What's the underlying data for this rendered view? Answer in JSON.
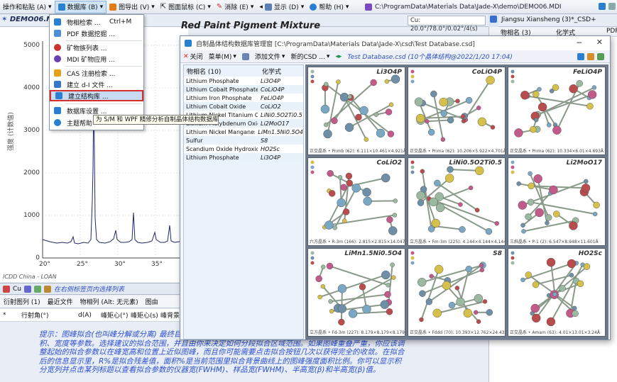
{
  "menubar": {
    "items": [
      {
        "label": "操作和粘贴 (A)",
        "arrow": "▾"
      },
      {
        "label": "数据库 (B)",
        "arrow": "▾"
      },
      {
        "label": "图导出 (V)",
        "arrow": "▾"
      },
      {
        "label": "图面鼠标 (C)",
        "arrow": "▾"
      },
      {
        "label": "消除 (E)",
        "arrow": "▾"
      },
      {
        "label": "显示 (D)",
        "arrow": "▾"
      },
      {
        "label": "帮助 (H)",
        "arrow": "▾"
      }
    ],
    "path": "C:\\ProgramData\\Materials Data\\Jade-X\\demo\\DEMO06.MDI"
  },
  "doc_tab": "DEMO06.MI",
  "cu_readout": "Cu: 20.0°/78.0°/0.02°/4(s)",
  "right_panel": {
    "title": "Jiangsu Xiansheng (3)*_CSD+",
    "col1": "物相名 (3)",
    "col2": "化学式",
    "col3": "PDF"
  },
  "plot": {
    "title": "Red Paint Pigment Mixture",
    "ylabel": "强度 (计数值)",
    "yticks": [
      "5000",
      "4000",
      "3000",
      "2000",
      "1000",
      "0"
    ],
    "xticks": [
      "20°",
      "25°",
      "30°",
      "35°"
    ],
    "footer": "ICDD China - LOAN"
  },
  "dropdown": {
    "items": [
      {
        "label": "物相检索 ...",
        "shortcut": "Ctrl+M"
      },
      {
        "label": "PDF 数据挖掘 ..."
      },
      {
        "label": "矿物族列表 ..."
      },
      {
        "label": "MDI 矿物应用 ..."
      },
      {
        "label": "CAS 注册检索 ..."
      },
      {
        "label": "建立 d-I 文件 ..."
      },
      {
        "label": "建立结构库 ..."
      },
      {
        "label": "数据库设置 ..."
      },
      {
        "label": "主题帮助"
      }
    ],
    "tooltip": "为 S/M 和 WPF 精修分析自制晶体结构数据库"
  },
  "bottom": {
    "toolbar_text": "在右侧标签页内选择列表",
    "toolbar_cu": "Cu",
    "tabs": [
      "衍射图列 (1)",
      "最近文件",
      "物相列 (Alt: 无元素)",
      "图由"
    ],
    "cols": [
      "行射角(°)",
      "d(A)",
      "峰矩心(°)",
      "峰矩心(s)",
      "峰背景"
    ],
    "row_marker": "*",
    "hint": "提示：图峰拟合(也叫峰分解或分离) 最终目的是利用峰形函数拟合所观测的峰形，据以精确确定峰的位置、面积、宽度等参数。选择建议的拟合范围，并且由你来决定如何分段拟合区域范围。如果图峰重叠严重，你应该调整起始的拟合参数以在峰宽高和位置上近似图峰，而且你可能需要点击拟合按钮几次以获得完全的收敛。在拟合后的信息显示里，R%是拟合残差值，面积%是当前范围里拟合背景曲线上的图峰强度面积比例。你可以显示积分宽列并点击某列标题以查看拟合参数的仪器宽(FWHM)、样品宽(FWHM)、半高宽(β)和半高宽(β)值。"
  },
  "dialog": {
    "title": "自制晶体结构数据库管理窗 [C:\\ProgramData\\Materials Data\\Jade-X\\csd\\Test Database.csd]",
    "toolbar": [
      "关闭",
      "菜单(M)",
      "添加文件",
      "新的CSD ...",
      "Test Database.csd (10个晶体结构@2022/1/20 17:04)"
    ],
    "list_header": {
      "name": "物相名",
      "count": "(10)",
      "formula": "化学式"
    },
    "rows": [
      {
        "name": "Lithium Phosphate",
        "formula": "Li3O4P"
      },
      {
        "name": "Lithium Cobalt Phosphate",
        "formula": "CoLiO4P"
      },
      {
        "name": "Lithium Iron Phosphate",
        "formula": "FeLiO4P"
      },
      {
        "name": "Lithium Cobalt Oxide",
        "formula": "CoLiO2"
      },
      {
        "name": "Lithium Nickel Titanium O...",
        "formula": "LiNi0.5O2Ti0.5"
      },
      {
        "name": "Lithium Molybdenum Oxide",
        "formula": "Li2MoO17"
      },
      {
        "name": "Lithium Nickel Manganes...",
        "formula": "LiMn1.5Ni0.5O4"
      },
      {
        "name": "Sulfur",
        "formula": "S8"
      },
      {
        "name": "Scandium Oxide Hydroxide",
        "formula": "HO2Sc"
      },
      {
        "name": "Lithium Phosphate",
        "formula": "Li3O4P"
      }
    ],
    "cells": [
      {
        "title": "Li3O4P",
        "caption": "正交晶系 • Pnmb (62): 6.111×10.461×4.921Å"
      },
      {
        "title": "CoLiO4P",
        "caption": "正交晶系 • Pnma (62): 10.206×5.922×4.701Å"
      },
      {
        "title": "FeLiO4P",
        "caption": "正交晶系 • Pnma (62): 10.334×6.01×4.693Å"
      },
      {
        "title": "CoLiO2",
        "caption": "六方晶系 • R-3m (166): 2.815×2.815×14.047Å"
      },
      {
        "title": "LiNi0.5O2Ti0.5",
        "caption": "立方晶系 • Fm-3m (225): 4.144×4.144×4.144Å"
      },
      {
        "title": "Li2MoO17",
        "caption": "三斜晶系 • P-1 (2): 6.547×8.948×11.601Å"
      },
      {
        "title": "LiMn1.5Ni0.5O4",
        "caption": "立方晶系 • Fd-3m (227): 8.179×8.179×8.179Å"
      },
      {
        "title": "S8",
        "caption": "正交晶系 • Fddd (70): 10.393×12.762×24.43Å"
      },
      {
        "title": "HO2Sc",
        "caption": "正交晶系 • Amam (63): 4.01×13.01×3.24Å"
      }
    ]
  },
  "colors": {
    "accent": "#c7dcf4",
    "highlight": "#d43030",
    "hint": "#2a4fd0"
  }
}
